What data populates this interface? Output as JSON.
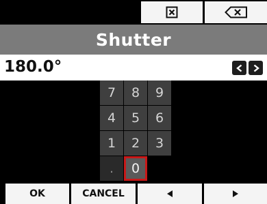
{
  "header": {
    "clear_icon": "clear-box-icon",
    "backspace_icon": "backspace-icon"
  },
  "title": "Shutter",
  "value": {
    "text": "180.0°",
    "decrement_icon": "chevron-left-icon",
    "increment_icon": "chevron-right-icon"
  },
  "keypad": {
    "keys": [
      "7",
      "8",
      "9",
      "4",
      "5",
      "6",
      "1",
      "2",
      "3",
      ".",
      "0"
    ],
    "selected": "0"
  },
  "footer": {
    "ok_label": "OK",
    "cancel_label": "CANCEL",
    "left_icon": "triangle-left-icon",
    "right_icon": "triangle-right-icon"
  },
  "colors": {
    "title_bar": "#7b7b7b",
    "key": "#3f3f3f",
    "selection_border": "#c81818"
  }
}
